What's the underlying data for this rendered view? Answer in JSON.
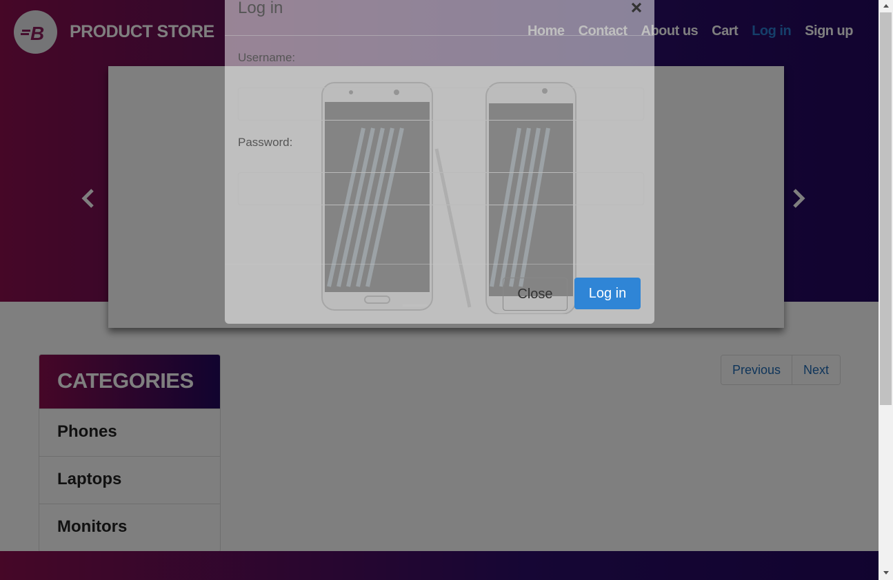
{
  "header": {
    "brand_name": "PRODUCT STORE",
    "logo_icon": "brand-b-logo-icon",
    "nav": [
      {
        "label": "Home"
      },
      {
        "label": "Contact"
      },
      {
        "label": "About us"
      },
      {
        "label": "Cart"
      },
      {
        "label": "Log in",
        "active": true
      },
      {
        "label": "Sign up"
      }
    ]
  },
  "carousel": {
    "prev_icon": "chevron-left-icon",
    "next_icon": "chevron-right-icon"
  },
  "categories": {
    "title": "CATEGORIES",
    "items": [
      {
        "label": "Phones"
      },
      {
        "label": "Laptops"
      },
      {
        "label": "Monitors"
      }
    ]
  },
  "pagination": {
    "previous_label": "Previous",
    "next_label": "Next"
  },
  "modal": {
    "title": "Log in",
    "close_icon": "close-icon",
    "username_label": "Username:",
    "username_value": "",
    "password_label": "Password:",
    "password_value": "",
    "close_button": "Close",
    "login_button": "Log in"
  },
  "colors": {
    "accent": "#2f85d6",
    "gradient_start": "#8c0e4f",
    "gradient_end": "#23085f"
  }
}
